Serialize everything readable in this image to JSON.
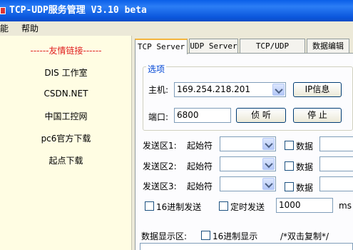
{
  "window": {
    "title": "TCP-UDP服务管理 V3.10 beta"
  },
  "menu": {
    "items": [
      "功能",
      "帮助"
    ]
  },
  "sidebar": {
    "header": "------友情链接------",
    "links": [
      "DIS 工作室",
      "CSDN.NET",
      "中国工控网",
      "pc6官方下载",
      "起点下载"
    ]
  },
  "tabs": [
    "TCP Server",
    "UDP Server",
    "TCP/UDP Client",
    "数据编辑"
  ],
  "active_tab": "TCP Server",
  "settings": {
    "legend": "选项",
    "host_label": "主机:",
    "host_value": "169.254.218.201",
    "ip_info_button": "IP信息",
    "port_label": "端口:",
    "port_value": "6800",
    "listen_button": "侦 听",
    "stop_button": "停 止"
  },
  "send_areas": [
    {
      "label": "发送区1:",
      "start_label": "起始符",
      "data_label": "数据"
    },
    {
      "label": "发送区2:",
      "start_label": "起始符",
      "data_label": "数据"
    },
    {
      "label": "发送区3:",
      "start_label": "起始符",
      "data_label": "数据"
    }
  ],
  "options": {
    "hex_send_label": "16进制发送",
    "timed_send_label": "定时发送",
    "interval_value": "1000",
    "interval_unit": "ms"
  },
  "display": {
    "label": "数据显示区:",
    "hex_display_label": "16进制显示",
    "hint": "/*双击复制*/"
  }
}
